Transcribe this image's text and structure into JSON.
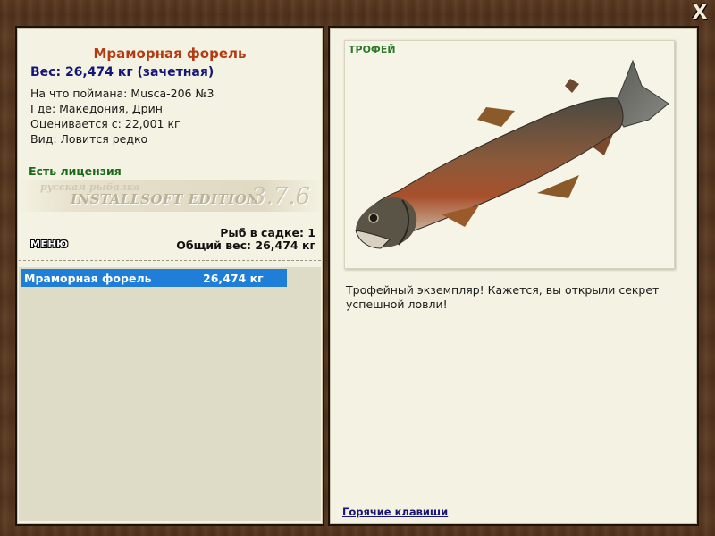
{
  "window": {
    "close_label": "X"
  },
  "fish": {
    "title": "Мраморная форель",
    "weight_line": "Вес: 26,474 кг (зачетная)",
    "bait_line": "На что поймана: Musca-206 №3",
    "location_line": "Где: Македония, Дрин",
    "min_weight_line": "Оценивается с: 22,001 кг",
    "rarity_line": "Вид: Ловится редко"
  },
  "license_text": "Есть лицензия",
  "banner": {
    "subtitle": "русская рыбалка",
    "edition": "INSTALLSOFT EDITION",
    "version": "3.7.6"
  },
  "keepnet": {
    "count_line": "Рыб в садке: 1",
    "total_line": "Общий вес: 26,474 кг"
  },
  "menu_label": "МЕНЮ",
  "catch_list": [
    {
      "name": "Мраморная форель",
      "weight": "26,474 кг"
    }
  ],
  "trophy_label": "ТРОФЕЙ",
  "description": "Трофейный экземпляр! Кажется, вы открыли секрет успешной ловли!",
  "hotkeys_label": "Горячие клавиши",
  "colors": {
    "title": "#b33a12",
    "weight": "#15157a",
    "license": "#1a6a1a",
    "selection": "#1f7fd8",
    "trophy": "#2e7a24"
  }
}
